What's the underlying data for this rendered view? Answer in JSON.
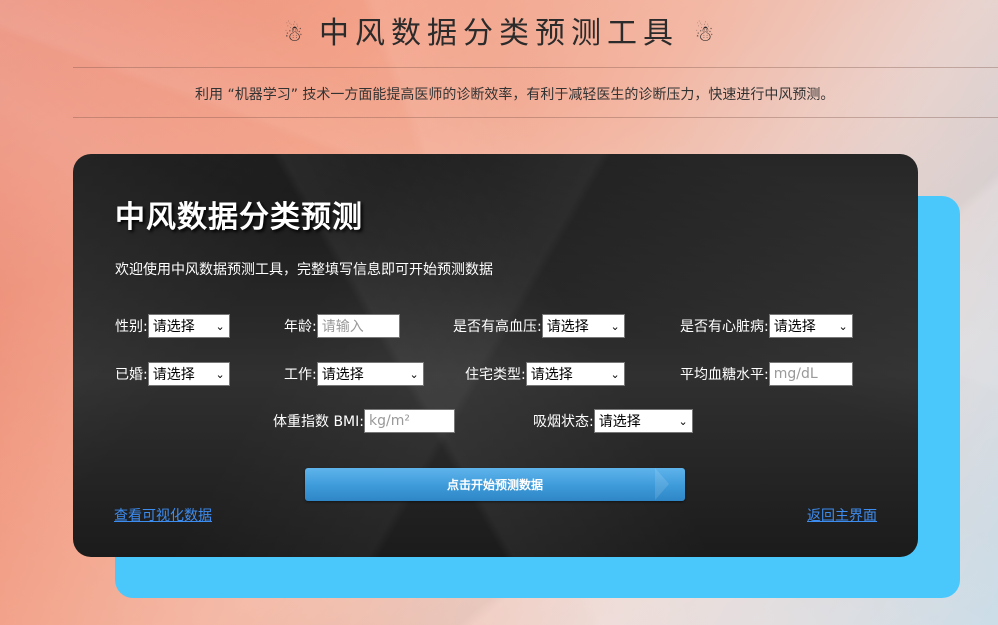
{
  "header": {
    "icon": "☃",
    "title": "中风数据分类预测工具",
    "subtitle": "利用 “机器学习” 技术一方面能提高医师的诊断效率，有利于减轻医生的诊断压力，快速进行中风预测。"
  },
  "panel": {
    "title": "中风数据分类预测",
    "welcome": "欢迎使用中风数据预测工具，完整填写信息即可开始预测数据"
  },
  "form": {
    "gender": {
      "label": "性别:",
      "value": "请选择"
    },
    "age": {
      "label": "年龄:",
      "placeholder": "请输入"
    },
    "hypertension": {
      "label": "是否有高血压:",
      "value": "请选择"
    },
    "heart_disease": {
      "label": "是否有心脏病:",
      "value": "请选择"
    },
    "married": {
      "label": "已婚:",
      "value": "请选择"
    },
    "work": {
      "label": "工作:",
      "value": "请选择"
    },
    "residence": {
      "label": "住宅类型:",
      "value": "请选择"
    },
    "glucose": {
      "label": "平均血糖水平:",
      "placeholder": "mg/dL"
    },
    "bmi": {
      "label": "体重指数 BMI:",
      "placeholder": "kg/m²"
    },
    "smoking": {
      "label": "吸烟状态:",
      "value": "请选择"
    }
  },
  "actions": {
    "predict_label": "点击开始预测数据",
    "view_chart_label": "查看可视化数据",
    "back_label": "返回主界面"
  },
  "colors": {
    "accent_blue": "#4bc8fb",
    "button_blue": "#3d9ad9",
    "link_blue": "#3d8cf0"
  }
}
